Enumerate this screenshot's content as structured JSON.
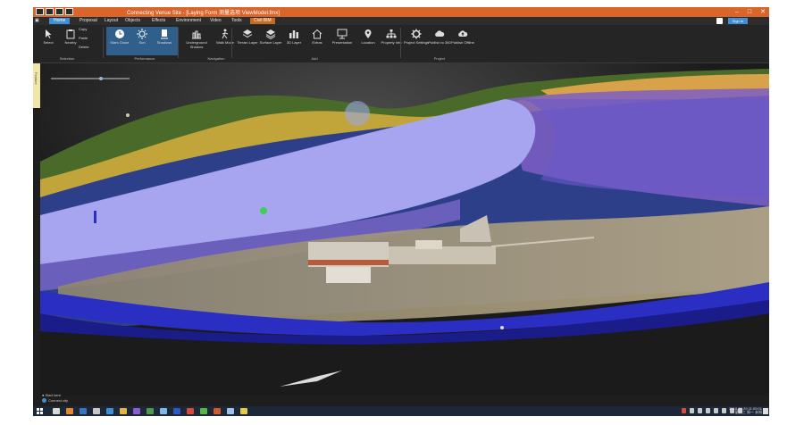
{
  "window": {
    "title": "Connecting Venue Site - [Laying Form 测量选项 ViewModel.fmx]",
    "controls": [
      "–",
      "□",
      "✕"
    ]
  },
  "menu": {
    "tabs": [
      {
        "label": "Home",
        "active": true
      },
      {
        "label": "Proposal"
      },
      {
        "label": "Layout"
      },
      {
        "label": "Objects"
      },
      {
        "label": "Effects"
      },
      {
        "label": "Environment"
      },
      {
        "label": "Video"
      },
      {
        "label": "Tools"
      },
      {
        "label": "Civil BIM",
        "highlight": true
      }
    ],
    "signin": "Sign In"
  },
  "ribbon": {
    "buttons": [
      {
        "label": "Select",
        "icon": "cursor-icon"
      },
      {
        "label": "Nearby",
        "icon": "clipboard-icon"
      },
      {
        "label": "Copy",
        "icon": "copy-icon"
      },
      {
        "label": "Paste",
        "icon": "paste-icon"
      },
      {
        "label": "Delete",
        "icon": "delete-icon"
      },
      {
        "label": "Stars Glows",
        "icon": "clock-icon",
        "active": true
      },
      {
        "label": "Sun",
        "icon": "sun-icon",
        "active": true
      },
      {
        "label": "Shadows",
        "icon": "shadow-icon",
        "active": true
      },
      {
        "label": "Underground Shadow",
        "icon": "building-icon"
      },
      {
        "label": "Walk Mode",
        "icon": "walk-icon"
      },
      {
        "label": "Terrain Layer",
        "icon": "layers-icon"
      },
      {
        "label": "Surface Layer",
        "icon": "surface-icon"
      },
      {
        "label": "3D Layer",
        "icon": "bars-icon"
      },
      {
        "label": "Extras",
        "icon": "house-icon"
      },
      {
        "label": "Presentation",
        "icon": "board-icon"
      },
      {
        "label": "Location",
        "icon": "pin-icon"
      },
      {
        "label": "Property Info",
        "icon": "tree-icon"
      },
      {
        "label": "Project Settings",
        "icon": "gear-icon"
      },
      {
        "label": "Publish to 360",
        "icon": "cloud-icon"
      },
      {
        "label": "Publish Offline",
        "icon": "cloud-upload-icon"
      }
    ],
    "groups": [
      "Selection",
      "Performance",
      "Navigation",
      "Add",
      "Project"
    ]
  },
  "side_panel": {
    "label": "Feature"
  },
  "viewport": {
    "status_line1": "● Start here",
    "status_line2": "Connect city"
  },
  "taskbar": {
    "clock_time": "2018-08-29 11:00:01",
    "clock_date": "星期三 周一 未知"
  },
  "colors": {
    "titlebar": "#d9652a",
    "accent": "#3e8fd4",
    "ribbon": "#252525",
    "taskbar": "#1c2838"
  }
}
